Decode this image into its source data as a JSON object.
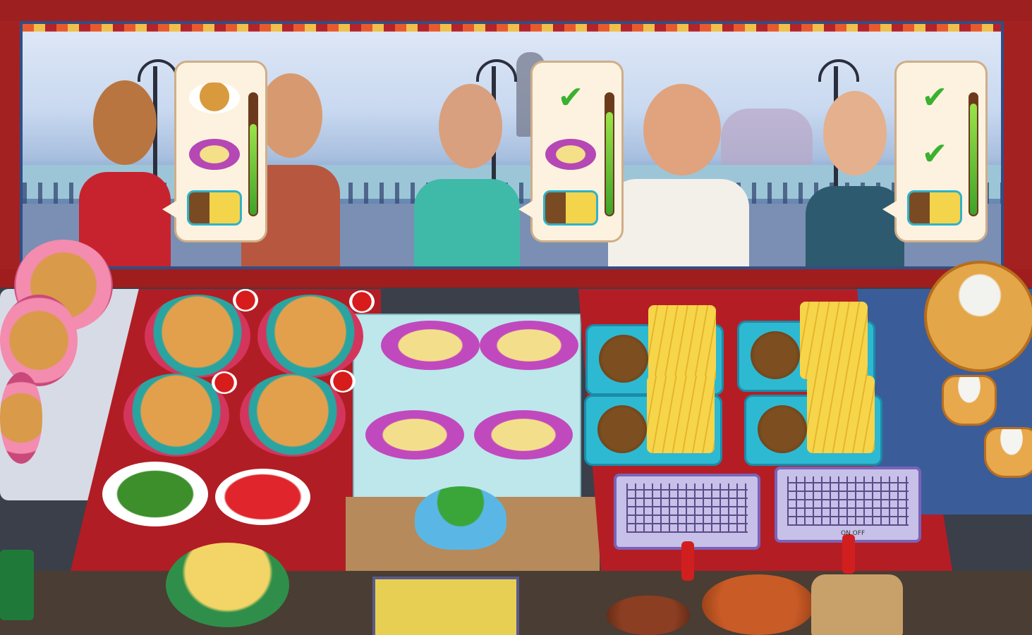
{
  "customers": [
    {
      "id": "bride",
      "orders": [
        {
          "item": "pav-bhaji",
          "done": false
        },
        {
          "item": "paneer-roll",
          "done": false
        },
        {
          "item": "chole-fries",
          "done": false
        }
      ],
      "patience": 0.75
    },
    {
      "id": "grandma",
      "orders": [
        {
          "item": "pav-bhaji",
          "done": true
        },
        {
          "item": "paneer-roll",
          "done": false
        },
        {
          "item": "chole-fries",
          "done": false
        }
      ],
      "patience": 0.85
    },
    {
      "id": "office-woman",
      "orders": [
        {
          "item": "pav-bhaji",
          "done": true
        },
        {
          "item": "paneer-roll",
          "done": true
        },
        {
          "item": "chole-fries",
          "done": false
        }
      ],
      "patience": 0.92
    }
  ],
  "fryers": [
    {
      "id": "fryer-1",
      "label": ""
    },
    {
      "id": "fryer-2",
      "label": "ON  OFF"
    }
  ],
  "icons": {
    "check": "✔",
    "order_done": "check-icon"
  },
  "colors": {
    "patience_fill": "#3fa329",
    "check": "#3ab12f",
    "bubble": "#fdf2df"
  }
}
